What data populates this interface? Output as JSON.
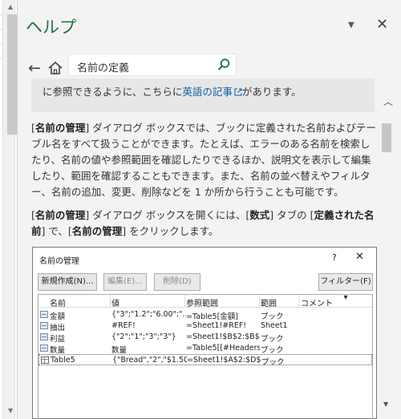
{
  "pane": {
    "title": "ヘルプ",
    "dropdown_icon": "chevron-down-icon",
    "close_icon": "close-icon"
  },
  "nav": {
    "back_icon": "back-arrow-icon",
    "home_icon": "home-icon",
    "search_value": "名前の定義",
    "search_icon": "search-icon"
  },
  "note": {
    "text_before": "に参照できるように、こちらに",
    "link_text": "英語の記事",
    "text_after": "があります。"
  },
  "para1": {
    "bold1": "名前の管理",
    "text1": "] ダイアログ ボックスでは、ブックに定義された名前およびテーブル名をすべて扱うことができます。たとえば、エラーのある名前を検索したり、名前の値や参照範囲を確認したりできるほか、説明文を表示して編集したり、範囲を確認することもできます。また、名前の並べ替えやフィルター、名前の追加、変更、削除などを 1 か所から行うことも可能です。"
  },
  "para2": {
    "bold1": "名前の管理",
    "text1": "] ダイアログ ボックスを開くには、[",
    "bold2": "数式",
    "text2": "] タブの [",
    "bold3": "定義された名前",
    "text3": "] で、[",
    "bold4": "名前の管理",
    "text4": "] をクリックします。"
  },
  "dialog": {
    "title": "名前の管理",
    "help": "?",
    "close": "✕",
    "buttons": {
      "new": "新規作成(N)...",
      "edit": "編集(E)...",
      "delete": "削除(D)",
      "filter": "フィルター(F) ▾"
    },
    "columns": [
      "名前",
      "値",
      "参照範囲",
      "範囲",
      "コメント"
    ],
    "rows": [
      {
        "name": "金額",
        "value": "{\"3\";\"1.2\";\"6.00\";\"...",
        "ref": "=Table5[金額]",
        "scope": "ブック",
        "comment": "",
        "icon": "name-icon"
      },
      {
        "name": "抽出",
        "value": "#REF!",
        "ref": "=Sheet1!#REF!",
        "scope": "Sheet1",
        "comment": "",
        "icon": "name-icon"
      },
      {
        "name": "利益",
        "value": "{\"2\";\"1\";\"3\";\"3\"}",
        "ref": "=Sheet1!$B$2:$B$5",
        "scope": "ブック",
        "comment": "",
        "icon": "name-icon"
      },
      {
        "name": "数量",
        "value": "数量",
        "ref": "=Table5[[#Headers...",
        "scope": "ブック",
        "comment": "",
        "icon": "name-icon"
      },
      {
        "name": "Table5",
        "value": "{\"Bread\",\"2\",\"$1.50...",
        "ref": "=Sheet1!$A$2:$D$5",
        "scope": "ブック",
        "comment": "",
        "icon": "table-icon"
      }
    ]
  },
  "colors": {
    "accent": "#217346",
    "link": "#0b5ea8",
    "pane_bg": "#f3f3f3"
  }
}
